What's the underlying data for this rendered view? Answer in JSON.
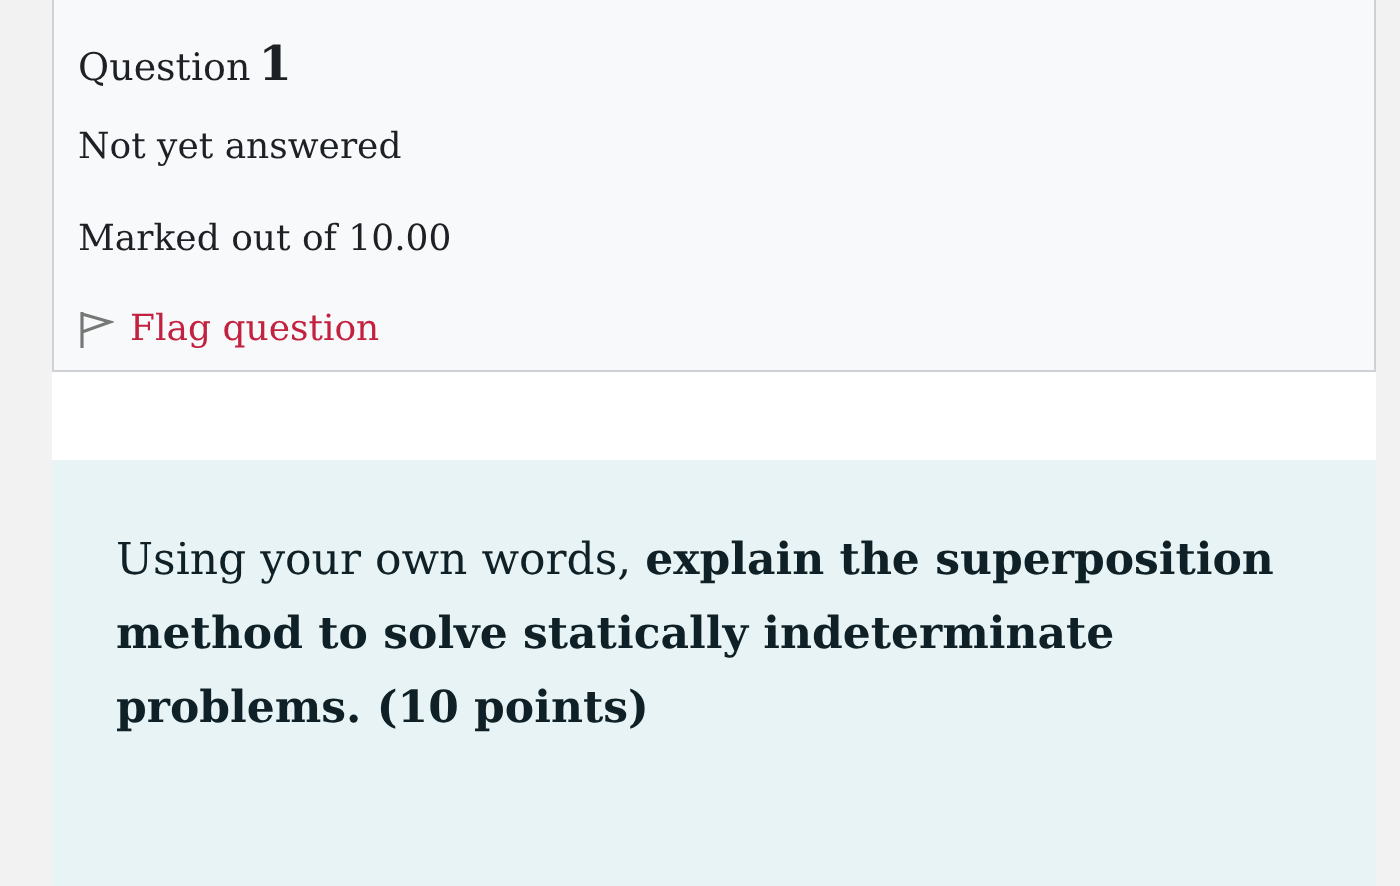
{
  "question_info": {
    "label": "Question",
    "number": "1",
    "state": "Not yet answered",
    "grade": "Marked out of 10.00",
    "flag_link": {
      "label": "Flag question",
      "flagged": false
    }
  },
  "question_text": "Using your own words, **explain the superposition method to solve statically indeterminate problems. (10 points)**"
}
